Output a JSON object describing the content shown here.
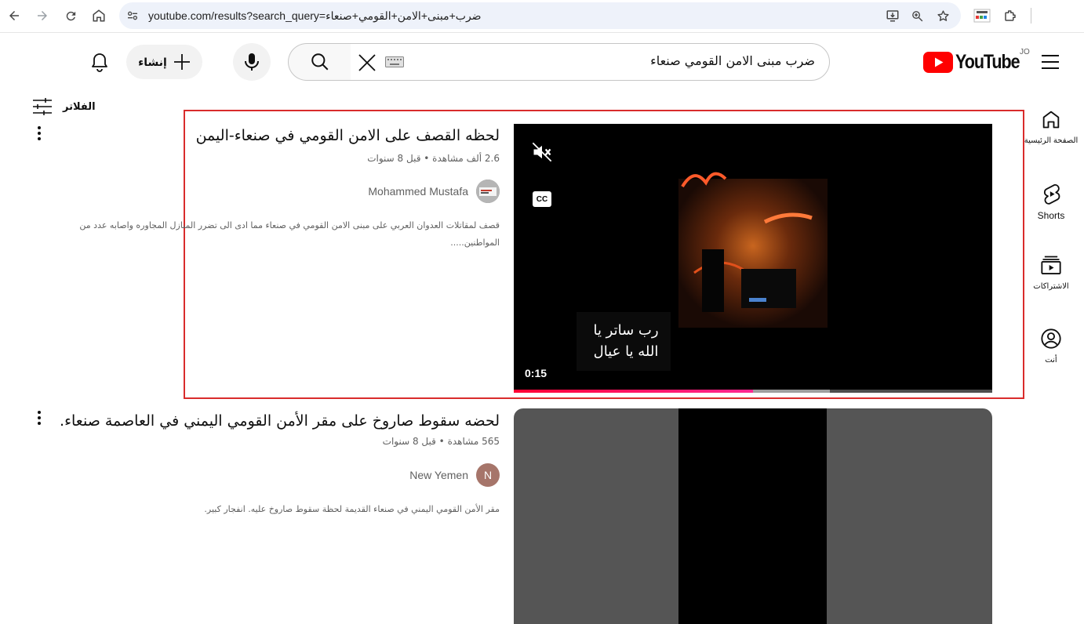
{
  "browser": {
    "url": "youtube.com/results?search_query=ضرب+مبنى+الامن+القومي+صنعاء"
  },
  "header": {
    "logo_text": "YouTube",
    "country_code": "JO",
    "search_value": "ضرب مبنى الامن القومي صنعاء",
    "create_label": "إنشاء"
  },
  "filters": {
    "label": "الفلاتر"
  },
  "sidebar": {
    "items": [
      {
        "label": "الصفحة الرئيسية",
        "icon": "home-icon"
      },
      {
        "label": "Shorts",
        "icon": "shorts-icon"
      },
      {
        "label": "الاشتراكات",
        "icon": "subscriptions-icon"
      },
      {
        "label": "أنت",
        "icon": "you-icon"
      }
    ]
  },
  "results": [
    {
      "title": "لحظه القصف على الامن القومي في صنعاء-اليمن",
      "meta": "2.6 ألف مشاهدة • قبل 8 سنوات",
      "channel": "Mohammed Mustafa",
      "description_line1": "قصف لمقاتلات العدوان العربي على مبنى الامن القومي في صنعاء مما ادى الى تضرر المنازل المجاوره واصابه عدد من",
      "description_line2": "المواطنين.....",
      "duration": "0:15",
      "caption_line1": "رب ساتر يا",
      "caption_line2": "الله يا عيال",
      "progress": 0.5,
      "buffered": 0.66
    },
    {
      "title": "لحضه سقوط صاروخ على مقر الأمن القومي اليمني في العاصمة صنعاء.",
      "meta": "565 مشاهدة • قبل 8 سنوات",
      "channel": "New Yemen",
      "avatar_letter": "N",
      "description_line1": "مقر الأمن القومي اليمني في صنعاء القديمة لحظة سقوط صاروخ عليه. انفجار كبير."
    }
  ],
  "colors": {
    "brand_red": "#ff0000",
    "highlight": "#d92c2c",
    "progress": "#ff0033",
    "avatar_new_yemen": "#a6756a"
  }
}
